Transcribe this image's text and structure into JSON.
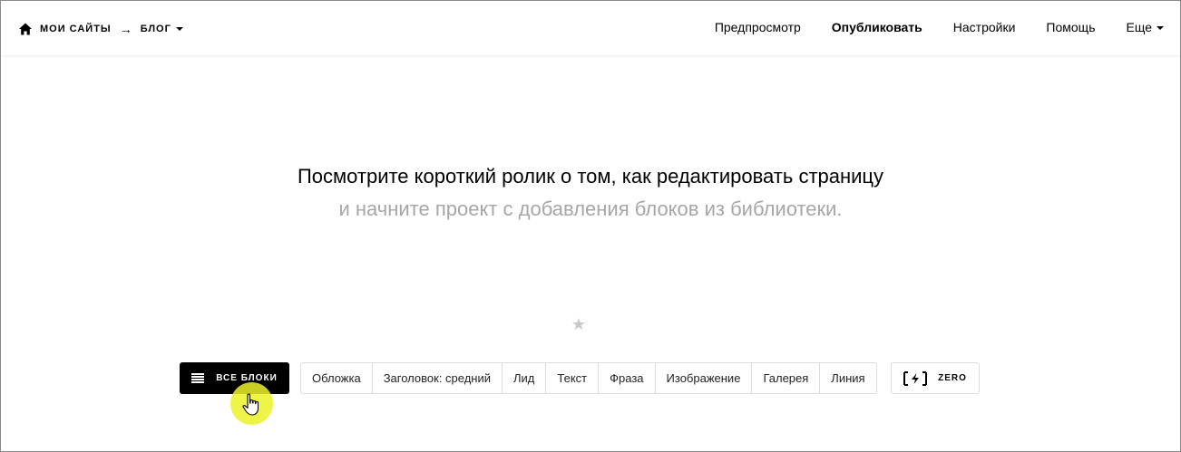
{
  "header": {
    "home_icon": "home-icon",
    "breadcrumb": {
      "sites_label": "МОИ САЙТЫ",
      "separator": "→",
      "current_label": "БЛОГ"
    },
    "nav": [
      {
        "label": "Предпросмотр",
        "bold": false
      },
      {
        "label": "Опубликовать",
        "bold": true
      },
      {
        "label": "Настройки",
        "bold": false
      },
      {
        "label": "Помощь",
        "bold": false
      },
      {
        "label": "Еще",
        "bold": false,
        "dropdown": true
      }
    ]
  },
  "hero": {
    "line1": "Посмотрите короткий ролик о том, как редактировать страницу",
    "line2": "и начните проект с добавления блоков из библиотеки."
  },
  "toolbar": {
    "all_blocks_label": "ВСЕ БЛОКИ",
    "chips": [
      "Обложка",
      "Заголовок: средний",
      "Лид",
      "Текст",
      "Фраза",
      "Изображение",
      "Галерея",
      "Линия"
    ],
    "zero_label": "ZERO"
  },
  "colors": {
    "accent_dark": "#000000",
    "muted_text": "#a6a6a6",
    "cursor_highlight": "#ebf228"
  }
}
